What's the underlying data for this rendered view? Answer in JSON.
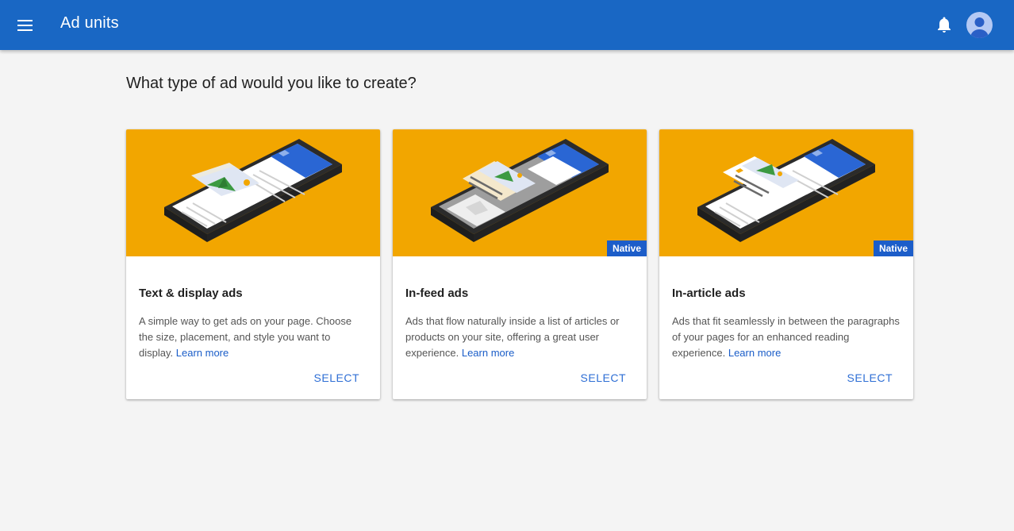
{
  "app": {
    "title": "Ad units"
  },
  "page": {
    "heading": "What type of ad would you like to create?"
  },
  "icons": {
    "menu": "menu-icon",
    "notifications": "bell-icon",
    "account": "account-avatar-icon"
  },
  "colors": {
    "topbar": "#1967c4",
    "hero_background": "#f2a600",
    "badge": "#1c5dc9",
    "link": "#1a5dc8",
    "select": "#2f6fd5"
  },
  "cards": [
    {
      "title": "Text & display ads",
      "description": "A simple way to get ads on your page. Choose the size, placement, and style you want to display.",
      "link_label": "Learn more",
      "select_label": "SELECT",
      "badge": ""
    },
    {
      "title": "In-feed ads",
      "description": "Ads that flow naturally inside a list of articles or products on your site, offering a great user experience.",
      "link_label": "Learn more",
      "select_label": "SELECT",
      "badge": "Native"
    },
    {
      "title": "In-article ads",
      "description": "Ads that fit seamlessly in between the paragraphs of your pages for an enhanced reading experience.",
      "link_label": "Learn more",
      "select_label": "SELECT",
      "badge": "Native"
    }
  ]
}
